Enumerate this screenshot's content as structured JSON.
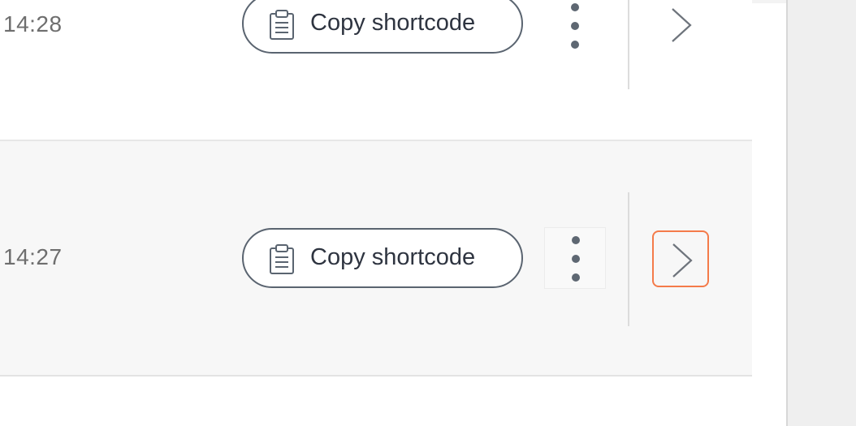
{
  "rows": [
    {
      "time": "14:28",
      "copy_label": "Copy shortcode",
      "more_icon": "kebab-vertical-icon",
      "open_icon": "chevron-right-icon",
      "focused": false
    },
    {
      "time": "14:27",
      "copy_label": "Copy shortcode",
      "more_icon": "kebab-vertical-icon",
      "open_icon": "chevron-right-icon",
      "focused": true
    }
  ],
  "colors": {
    "focus_ring": "#f47b4a",
    "button_border": "#5a6470",
    "text_primary": "#2e3440",
    "text_muted": "#6e6e6e",
    "row_hover_bg": "#f7f7f7",
    "gutter_bg": "#efefef"
  }
}
